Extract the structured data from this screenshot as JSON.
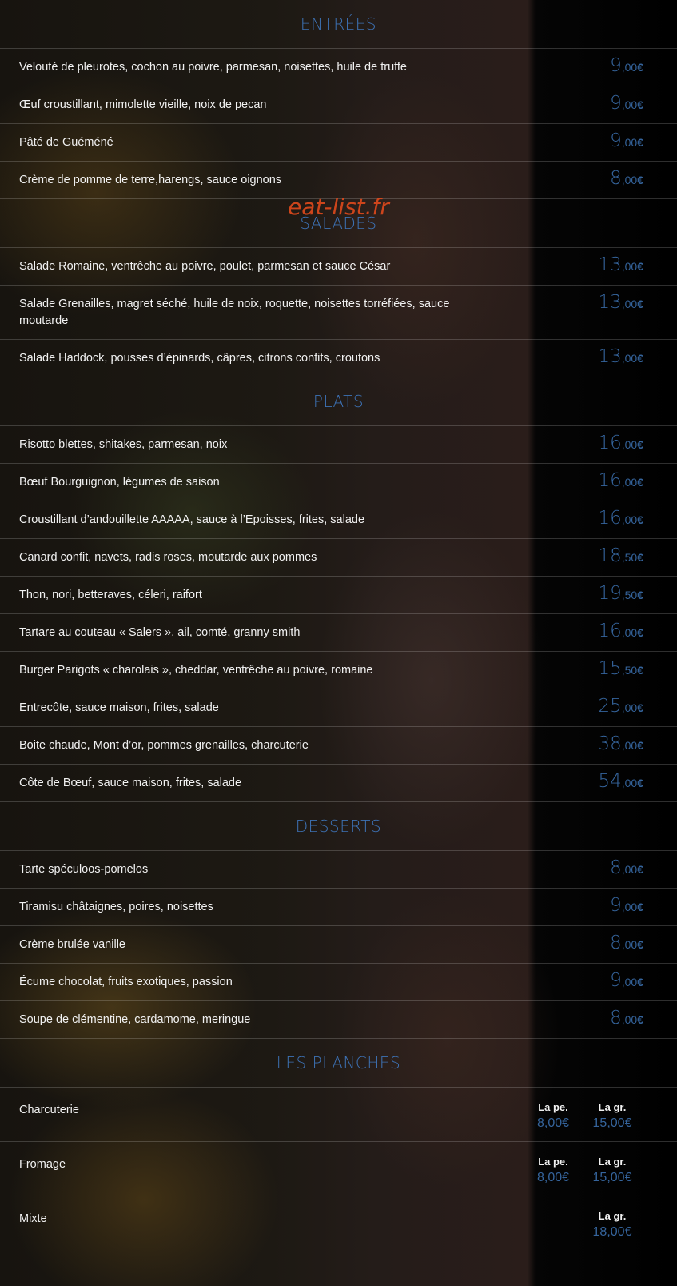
{
  "watermark": "eat-list.fr",
  "currency": "€",
  "sections": [
    {
      "title": "ENTRÉES",
      "items": [
        {
          "name": "Velouté de pleurotes, cochon au poivre, parmesan, noisettes, huile de truffe",
          "int": "9",
          "dec": ",00"
        },
        {
          "name": "Œuf croustillant, mimolette vieille, noix de pecan",
          "int": "9",
          "dec": ",00"
        },
        {
          "name": "Pâté de Guéméné",
          "int": "9",
          "dec": ",00"
        },
        {
          "name": "Crème de pomme de terre,harengs, sauce oignons",
          "int": "8",
          "dec": ",00"
        }
      ]
    },
    {
      "title": "SALADES",
      "items": [
        {
          "name": "Salade Romaine, ventrêche au poivre, poulet, parmesan et sauce César",
          "int": "13",
          "dec": ",00"
        },
        {
          "name": "Salade Grenailles, magret séché, huile de noix, roquette, noisettes torréfiées, sauce moutarde",
          "int": "13",
          "dec": ",00"
        },
        {
          "name": "Salade Haddock, pousses d’épinards, câpres, citrons confits, croutons",
          "int": "13",
          "dec": ",00"
        }
      ]
    },
    {
      "title": "PLATS",
      "items": [
        {
          "name": "Risotto blettes, shitakes, parmesan, noix",
          "int": "16",
          "dec": ",00"
        },
        {
          "name": "Bœuf Bourguignon, légumes de saison",
          "int": "16",
          "dec": ",00"
        },
        {
          "name": "Croustillant d’andouillette AAAAA, sauce à l’Epoisses, frites, salade",
          "int": "16",
          "dec": ",00"
        },
        {
          "name": "Canard confit, navets, radis roses, moutarde aux pommes",
          "int": "18",
          "dec": ",50"
        },
        {
          "name": "Thon, nori, betteraves, céleri, raifort",
          "int": "19",
          "dec": ",50"
        },
        {
          "name": "Tartare au couteau « Salers », ail, comté, granny smith",
          "int": "16",
          "dec": ",00"
        },
        {
          "name": "Burger Parigots « charolais », cheddar, ventrêche au poivre, romaine",
          "int": "15",
          "dec": ",50"
        },
        {
          "name": "Entrecôte, sauce maison, frites, salade",
          "int": "25",
          "dec": ",00"
        },
        {
          "name": "Boite chaude, Mont d’or, pommes grenailles, charcuterie",
          "int": "38",
          "dec": ",00"
        },
        {
          "name": "Côte de Bœuf, sauce maison, frites, salade",
          "int": "54",
          "dec": ",00"
        }
      ]
    },
    {
      "title": "DESSERTS",
      "items": [
        {
          "name": "Tarte spéculoos-pomelos",
          "int": "8",
          "dec": ",00"
        },
        {
          "name": "Tiramisu châtaignes, poires, noisettes",
          "int": "9",
          "dec": ",00"
        },
        {
          "name": "Crème brulée vanille",
          "int": "8",
          "dec": ",00"
        },
        {
          "name": "Écume chocolat, fruits exotiques, passion",
          "int": "9",
          "dec": ",00"
        },
        {
          "name": "Soupe de clémentine, cardamome, meringue",
          "int": "8",
          "dec": ",00"
        }
      ]
    }
  ],
  "planches": {
    "title": "LES PLANCHES",
    "small_label": "La pe.",
    "large_label": "La gr.",
    "items": [
      {
        "name": "Charcuterie",
        "small_int": "8",
        "small_dec": ",00",
        "large_int": "15",
        "large_dec": ",00"
      },
      {
        "name": "Fromage",
        "small_int": "8",
        "small_dec": ",00",
        "large_int": "15",
        "large_dec": ",00"
      },
      {
        "name": "Mixte",
        "large_int": "18",
        "large_dec": ",00"
      }
    ]
  }
}
